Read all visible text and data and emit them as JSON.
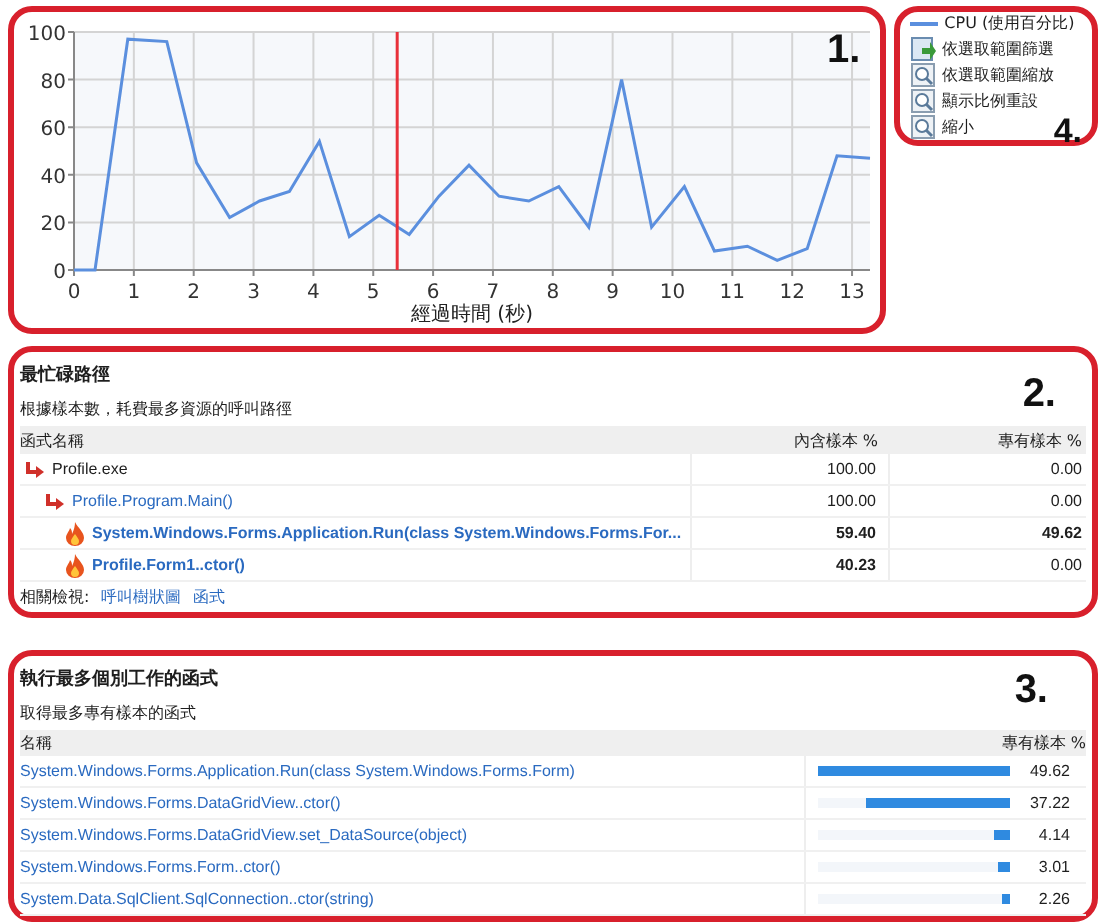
{
  "chart": {
    "number_label": "1.",
    "chart_data": {
      "type": "line",
      "xlabel": "經過時間 (秒)",
      "xlim": [
        0,
        13.3
      ],
      "ylim": [
        0,
        100
      ],
      "xticks": [
        0,
        1,
        2,
        3,
        4,
        5,
        6,
        7,
        8,
        9,
        10,
        11,
        12,
        13
      ],
      "yticks": [
        0,
        20,
        40,
        60,
        80,
        100
      ],
      "x": [
        0,
        0.35,
        0.9,
        1.55,
        2.05,
        2.6,
        3.1,
        3.6,
        4.1,
        4.6,
        5.1,
        5.6,
        6.1,
        6.6,
        7.1,
        7.6,
        8.1,
        8.6,
        9.15,
        9.65,
        10.2,
        10.7,
        11.25,
        11.75,
        12.25,
        12.75,
        13.3
      ],
      "series": [
        {
          "name": "CPU (使用百分比)",
          "color": "#5b8fde",
          "values": [
            0,
            0,
            97,
            96,
            45,
            22,
            29,
            33,
            54,
            14,
            23,
            15,
            31,
            44,
            31,
            29,
            35,
            18,
            80,
            18,
            35,
            8,
            10,
            4,
            9,
            48,
            47
          ]
        }
      ],
      "grid": true,
      "ref_lines": [
        {
          "axis": "x",
          "value": 5.4,
          "color": "#e8303a"
        }
      ]
    }
  },
  "legend": {
    "number_label": "4.",
    "actions": [
      {
        "label": "依選取範圍篩選",
        "kind": "filter"
      },
      {
        "label": "依選取範圍縮放",
        "kind": "zoom"
      },
      {
        "label": "顯示比例重設",
        "kind": "zoom"
      },
      {
        "label": "縮小",
        "kind": "zoom"
      }
    ]
  },
  "hot_path": {
    "number_label": "2.",
    "title": "最忙碌路徑",
    "subtitle": "根據樣本數，耗費最多資源的呼叫路徑",
    "columns": [
      "函式名稱",
      "內含樣本 %",
      "專有樣本 %"
    ],
    "rows": [
      {
        "name": "Profile.exe",
        "kind": "arrow",
        "link": false,
        "inclusive": "100.00",
        "exclusive": "0.00",
        "children": [
          {
            "name": "Profile.Program.Main()",
            "kind": "arrow",
            "link": true,
            "inclusive": "100.00",
            "exclusive": "0.00",
            "children": [
              {
                "name": "System.Windows.Forms.Application.Run(class System.Windows.Forms.For...",
                "kind": "flame",
                "link": true,
                "inclusive": "59.40",
                "exclusive": "49.62"
              },
              {
                "name": "Profile.Form1..ctor()",
                "kind": "flame",
                "link": true,
                "inclusive": "40.23",
                "exclusive": "0.00"
              }
            ]
          }
        ]
      }
    ],
    "related_label": "相關檢視:",
    "related_links": [
      "呼叫樹狀圖",
      "函式"
    ]
  },
  "functions": {
    "number_label": "3.",
    "title": "執行最多個別工作的函式",
    "subtitle": "取得最多專有樣本的函式",
    "columns": [
      "名稱",
      "專有樣本 %"
    ],
    "rows": [
      {
        "name": "System.Windows.Forms.Application.Run(class System.Windows.Forms.Form)",
        "level": 1,
        "value": "49.62"
      },
      {
        "name": "System.Windows.Forms.DataGridView..ctor()",
        "level": 0.75,
        "value": "37.22"
      },
      {
        "name": "System.Windows.Forms.DataGridView.set_DataSource(object)",
        "level": 0.083,
        "value": "4.14"
      },
      {
        "name": "System.Windows.Forms.Form..ctor()",
        "level": 0.061,
        "value": "3.01"
      },
      {
        "name": "System.Data.SqlClient.SqlConnection..ctor(string)",
        "level": 0.046,
        "value": "2.26"
      }
    ]
  }
}
